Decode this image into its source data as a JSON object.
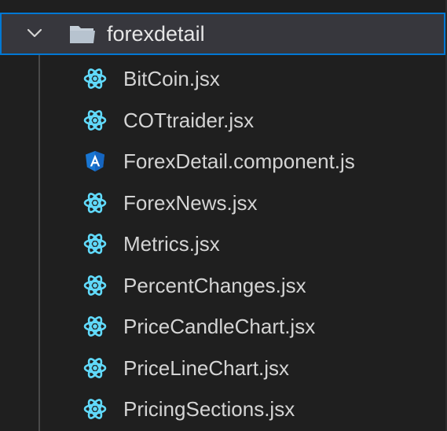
{
  "explorer": {
    "folder": {
      "name": "forexdetail",
      "expanded": true,
      "chevron_icon": "chevron-down-icon",
      "folder_icon": "open-folder-icon"
    },
    "files": [
      {
        "name": "BitCoin.jsx",
        "icon": "react-icon"
      },
      {
        "name": "COTtraider.jsx",
        "icon": "react-icon"
      },
      {
        "name": "ForexDetail.component.js",
        "icon": "angular-icon"
      },
      {
        "name": "ForexNews.jsx",
        "icon": "react-icon"
      },
      {
        "name": "Metrics.jsx",
        "icon": "react-icon"
      },
      {
        "name": "PercentChanges.jsx",
        "icon": "react-icon"
      },
      {
        "name": "PriceCandleChart.jsx",
        "icon": "react-icon"
      },
      {
        "name": "PriceLineChart.jsx",
        "icon": "react-icon"
      },
      {
        "name": "PricingSections.jsx",
        "icon": "react-icon"
      }
    ]
  },
  "colors": {
    "react": "#61dafb",
    "angular": "#1976d2",
    "selection_border": "#0078d4",
    "selection_bg": "#37373d"
  }
}
